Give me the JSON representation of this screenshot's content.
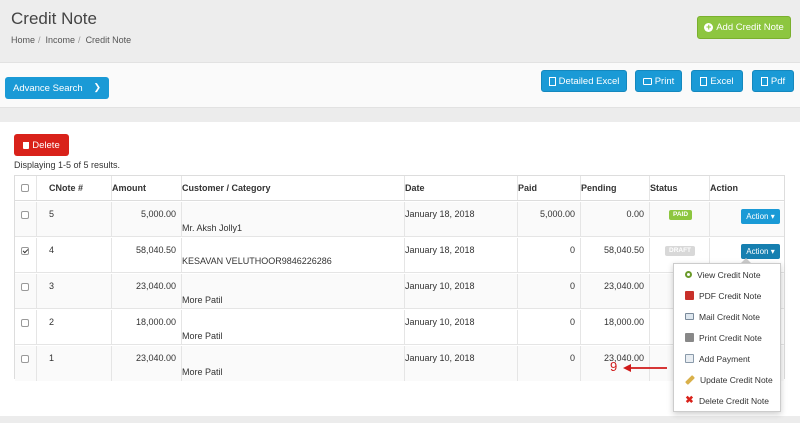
{
  "header": {
    "title": "Credit Note",
    "breadcrumb": [
      "Home",
      "Income",
      "Credit Note"
    ],
    "add_button": "Add Credit Note"
  },
  "toolbar": {
    "advance_search": "Advance Search",
    "detailed_excel": "Detailed Excel",
    "print": "Print",
    "excel": "Excel",
    "pdf": "Pdf"
  },
  "list": {
    "delete_label": "Delete",
    "summary": "Displaying 1-5 of 5 results.",
    "columns": [
      "CNote #",
      "Amount",
      "Customer / Category",
      "Date",
      "Paid",
      "Pending",
      "Status",
      "Action"
    ],
    "rows": [
      {
        "checked": false,
        "cnote": "5",
        "amount": "5,000.00",
        "customer": "Mr. Aksh Jolly1",
        "date": "January 18, 2018",
        "paid": "5,000.00",
        "pending": "0.00",
        "status": "PAID",
        "action": "Action"
      },
      {
        "checked": true,
        "cnote": "4",
        "amount": "58,040.50",
        "customer": "KESAVAN VELUTHOOR9846226286",
        "date": "January 18, 2018",
        "paid": "0",
        "pending": "58,040.50",
        "status": "DRAFT",
        "action": "Action"
      },
      {
        "checked": false,
        "cnote": "3",
        "amount": "23,040.00",
        "customer": "More Patil",
        "date": "January 10, 2018",
        "paid": "0",
        "pending": "23,040.00",
        "status": "",
        "action": ""
      },
      {
        "checked": false,
        "cnote": "2",
        "amount": "18,000.00",
        "customer": "More Patil",
        "date": "January 10, 2018",
        "paid": "0",
        "pending": "18,000.00",
        "status": "",
        "action": ""
      },
      {
        "checked": false,
        "cnote": "1",
        "amount": "23,040.00",
        "customer": "More Patil",
        "date": "January 10, 2018",
        "paid": "0",
        "pending": "23,040.00",
        "status": "",
        "action": ""
      }
    ]
  },
  "dropdown": {
    "items": [
      {
        "label": "View Credit Note",
        "icon": "magnifier-icon"
      },
      {
        "label": "PDF Credit Note",
        "icon": "pdf-icon"
      },
      {
        "label": "Mail Credit Note",
        "icon": "mail-icon"
      },
      {
        "label": "Print Credit Note",
        "icon": "printer-icon"
      },
      {
        "label": "Add Payment",
        "icon": "add-payment-icon"
      },
      {
        "label": "Update Credit Note",
        "icon": "pencil-icon"
      },
      {
        "label": "Delete Credit Note",
        "icon": "delete-icon"
      }
    ]
  },
  "annotation": "9",
  "colors": {
    "primary": "#1a9ad6",
    "success": "#8dc63f",
    "danger": "#d9221a",
    "paid": "#8dc63f",
    "draft": "#d8d8d8",
    "annotation": "#d01a1a"
  }
}
